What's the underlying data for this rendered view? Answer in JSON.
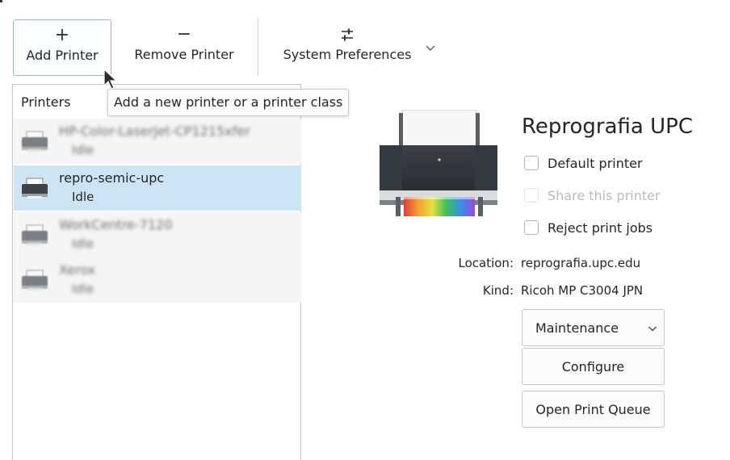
{
  "toolbar": {
    "add_label": "Add Printer",
    "add_icon": "+",
    "remove_label": "Remove Printer",
    "remove_icon": "−",
    "prefs_label": "System Preferences"
  },
  "tooltip": {
    "text": "Add a new printer or a printer class"
  },
  "printer_list": {
    "header": "Printers",
    "items": [
      {
        "name": "HP-Color-LaserJet-CP1215xfer",
        "status": "Idle",
        "blurred": true
      },
      {
        "name": "repro-semic-upc",
        "status": "Idle",
        "selected": true
      },
      {
        "name": "WorkCentre-7120",
        "status": "Idle",
        "blurred": true
      },
      {
        "name": "Xerox",
        "status": "Idle",
        "blurred": true
      }
    ]
  },
  "details": {
    "title": "Reprografia UPC",
    "default_printer_label": "Default printer",
    "share_printer_label": "Share this printer",
    "reject_jobs_label": "Reject print jobs",
    "location_label": "Location:",
    "location_value": "reprografia.upc.edu",
    "kind_label": "Kind:",
    "kind_value": "Ricoh MP C3004 JPN",
    "maintenance_label": "Maintenance",
    "configure_label": "Configure",
    "open_queue_label": "Open Print Queue"
  },
  "colors": {
    "selection": "#cde4f5",
    "focus_border": "#8fb8d8"
  }
}
